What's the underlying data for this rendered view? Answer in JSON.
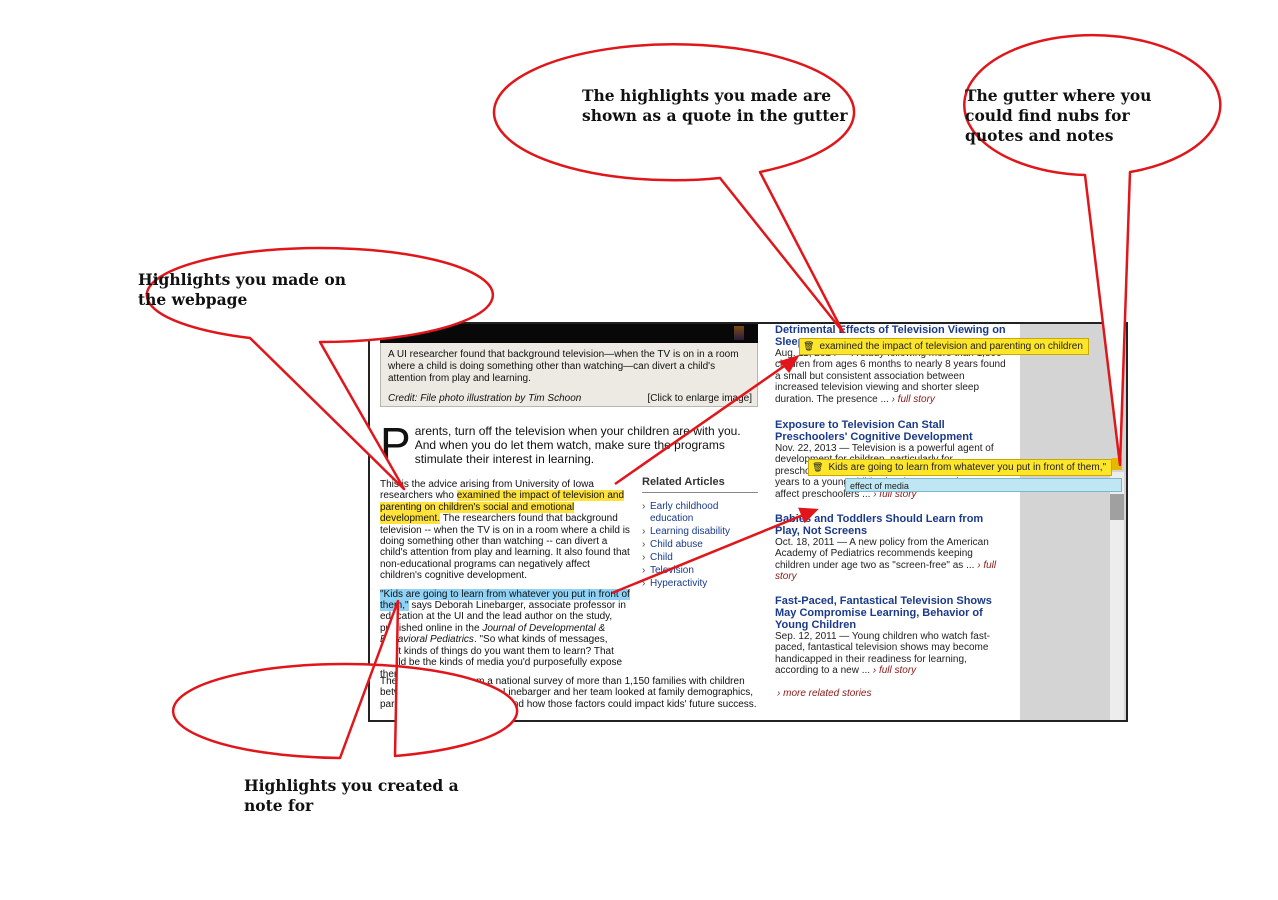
{
  "callouts": {
    "top_center": "The highlights you made are shown as a quote in the gutter",
    "top_right": "The gutter where you could find nubs for quotes and notes",
    "left": "Highlights you made on the webpage",
    "bottom": "Highlights you created a note for"
  },
  "article": {
    "caption": "A UI researcher found that background television—when the TV is on in a room where a child is doing something other than watching—can divert a child's attention from play and learning.",
    "credit": "Credit: File photo illustration by Tim Schoon",
    "enlarge_link": "[Click to enlarge image]",
    "dropcap": "P",
    "lead_rest": "arents, turn off the television when your children are with you. And when you do let them watch, make sure the programs stimulate their interest in learning.",
    "p1_start": "This is the advice arising from University of Iowa researchers who ",
    "p1_highlight": "examined the impact of television and parenting on children's social and emotional development.",
    "p1_rest": " The researchers found that background television -- when the TV is on in a room where a child is doing something other than watching -- can divert a child's attention from play and learning. It also found that non-educational programs can negatively affect children's cognitive development.",
    "p2_highlight": "\"Kids are going to learn from whatever you put in front of them,\"",
    "p2_rest_a": " says Deborah Linebarger, associate professor in education at the UI and the lead author on the study, published online in the ",
    "p2_journal": "Journal of Developmental & Behavioral Pediatrics",
    "p2_rest_b": ". \"So what kinds of messages, what kinds of things do you want them to learn? That would be the kinds of media you'd purposefully expose them to.\"",
    "p3": "The findings come from a national survey of more than 1,150 families with children between 2 and 8 years old. Linebarger and her team looked at family demographics, parenting styles, media use, and how those factors could impact kids' future success."
  },
  "related": {
    "heading": "Related Articles",
    "items": [
      "Early childhood education",
      "Learning disability",
      "Child abuse",
      "Child",
      "Television",
      "Hyperactivity"
    ]
  },
  "stories": [
    {
      "title": "Detrimental Effects of Television Viewing on Sleep",
      "meta": "Aug. 11, 2014 — A study following more than 1,800 children from ages 6 months to nearly 8 years found a small but consistent association between increased television viewing and shorter sleep duration. The presence ...",
      "full": "› full story"
    },
    {
      "title": "Exposure to Television Can Stall Preschoolers' Cognitive Development",
      "meta": "Nov. 22, 2013 — Television is a powerful agent of development for children, particularly for preschoolers. Television exposure at ages 4 to 6 years to a young child's development and may affect preschoolers ...",
      "full": "› full story"
    },
    {
      "title": "Babies and Toddlers Should Learn from Play, Not Screens",
      "meta": "Oct. 18, 2011 — A new policy from the American Academy of Pediatrics recommends keeping children under age two as \"screen-free\" as ...",
      "full": "› full story"
    },
    {
      "title": "Fast-Paced, Fantastical Television Shows May Compromise Learning, Behavior of Young Children",
      "meta": "Sep. 12, 2011 — Young children who watch fast-paced, fantastical television shows may become handicapped in their readiness for learning, according to a new ...",
      "full": "› full story"
    }
  ],
  "more_stories": "› more related stories",
  "gutter": {
    "quote1": "examined the impact of television and parenting on children",
    "quote2": "Kids are going to learn from whatever you put in front of them,\"",
    "note": "effect of media"
  },
  "colors": {
    "quote_highlight": "#ffe23a",
    "note_highlight": "#8fd2f5",
    "callout_border": "#e0161b",
    "link": "#1a3a8a"
  },
  "icons": {
    "trash": "trash-icon"
  }
}
